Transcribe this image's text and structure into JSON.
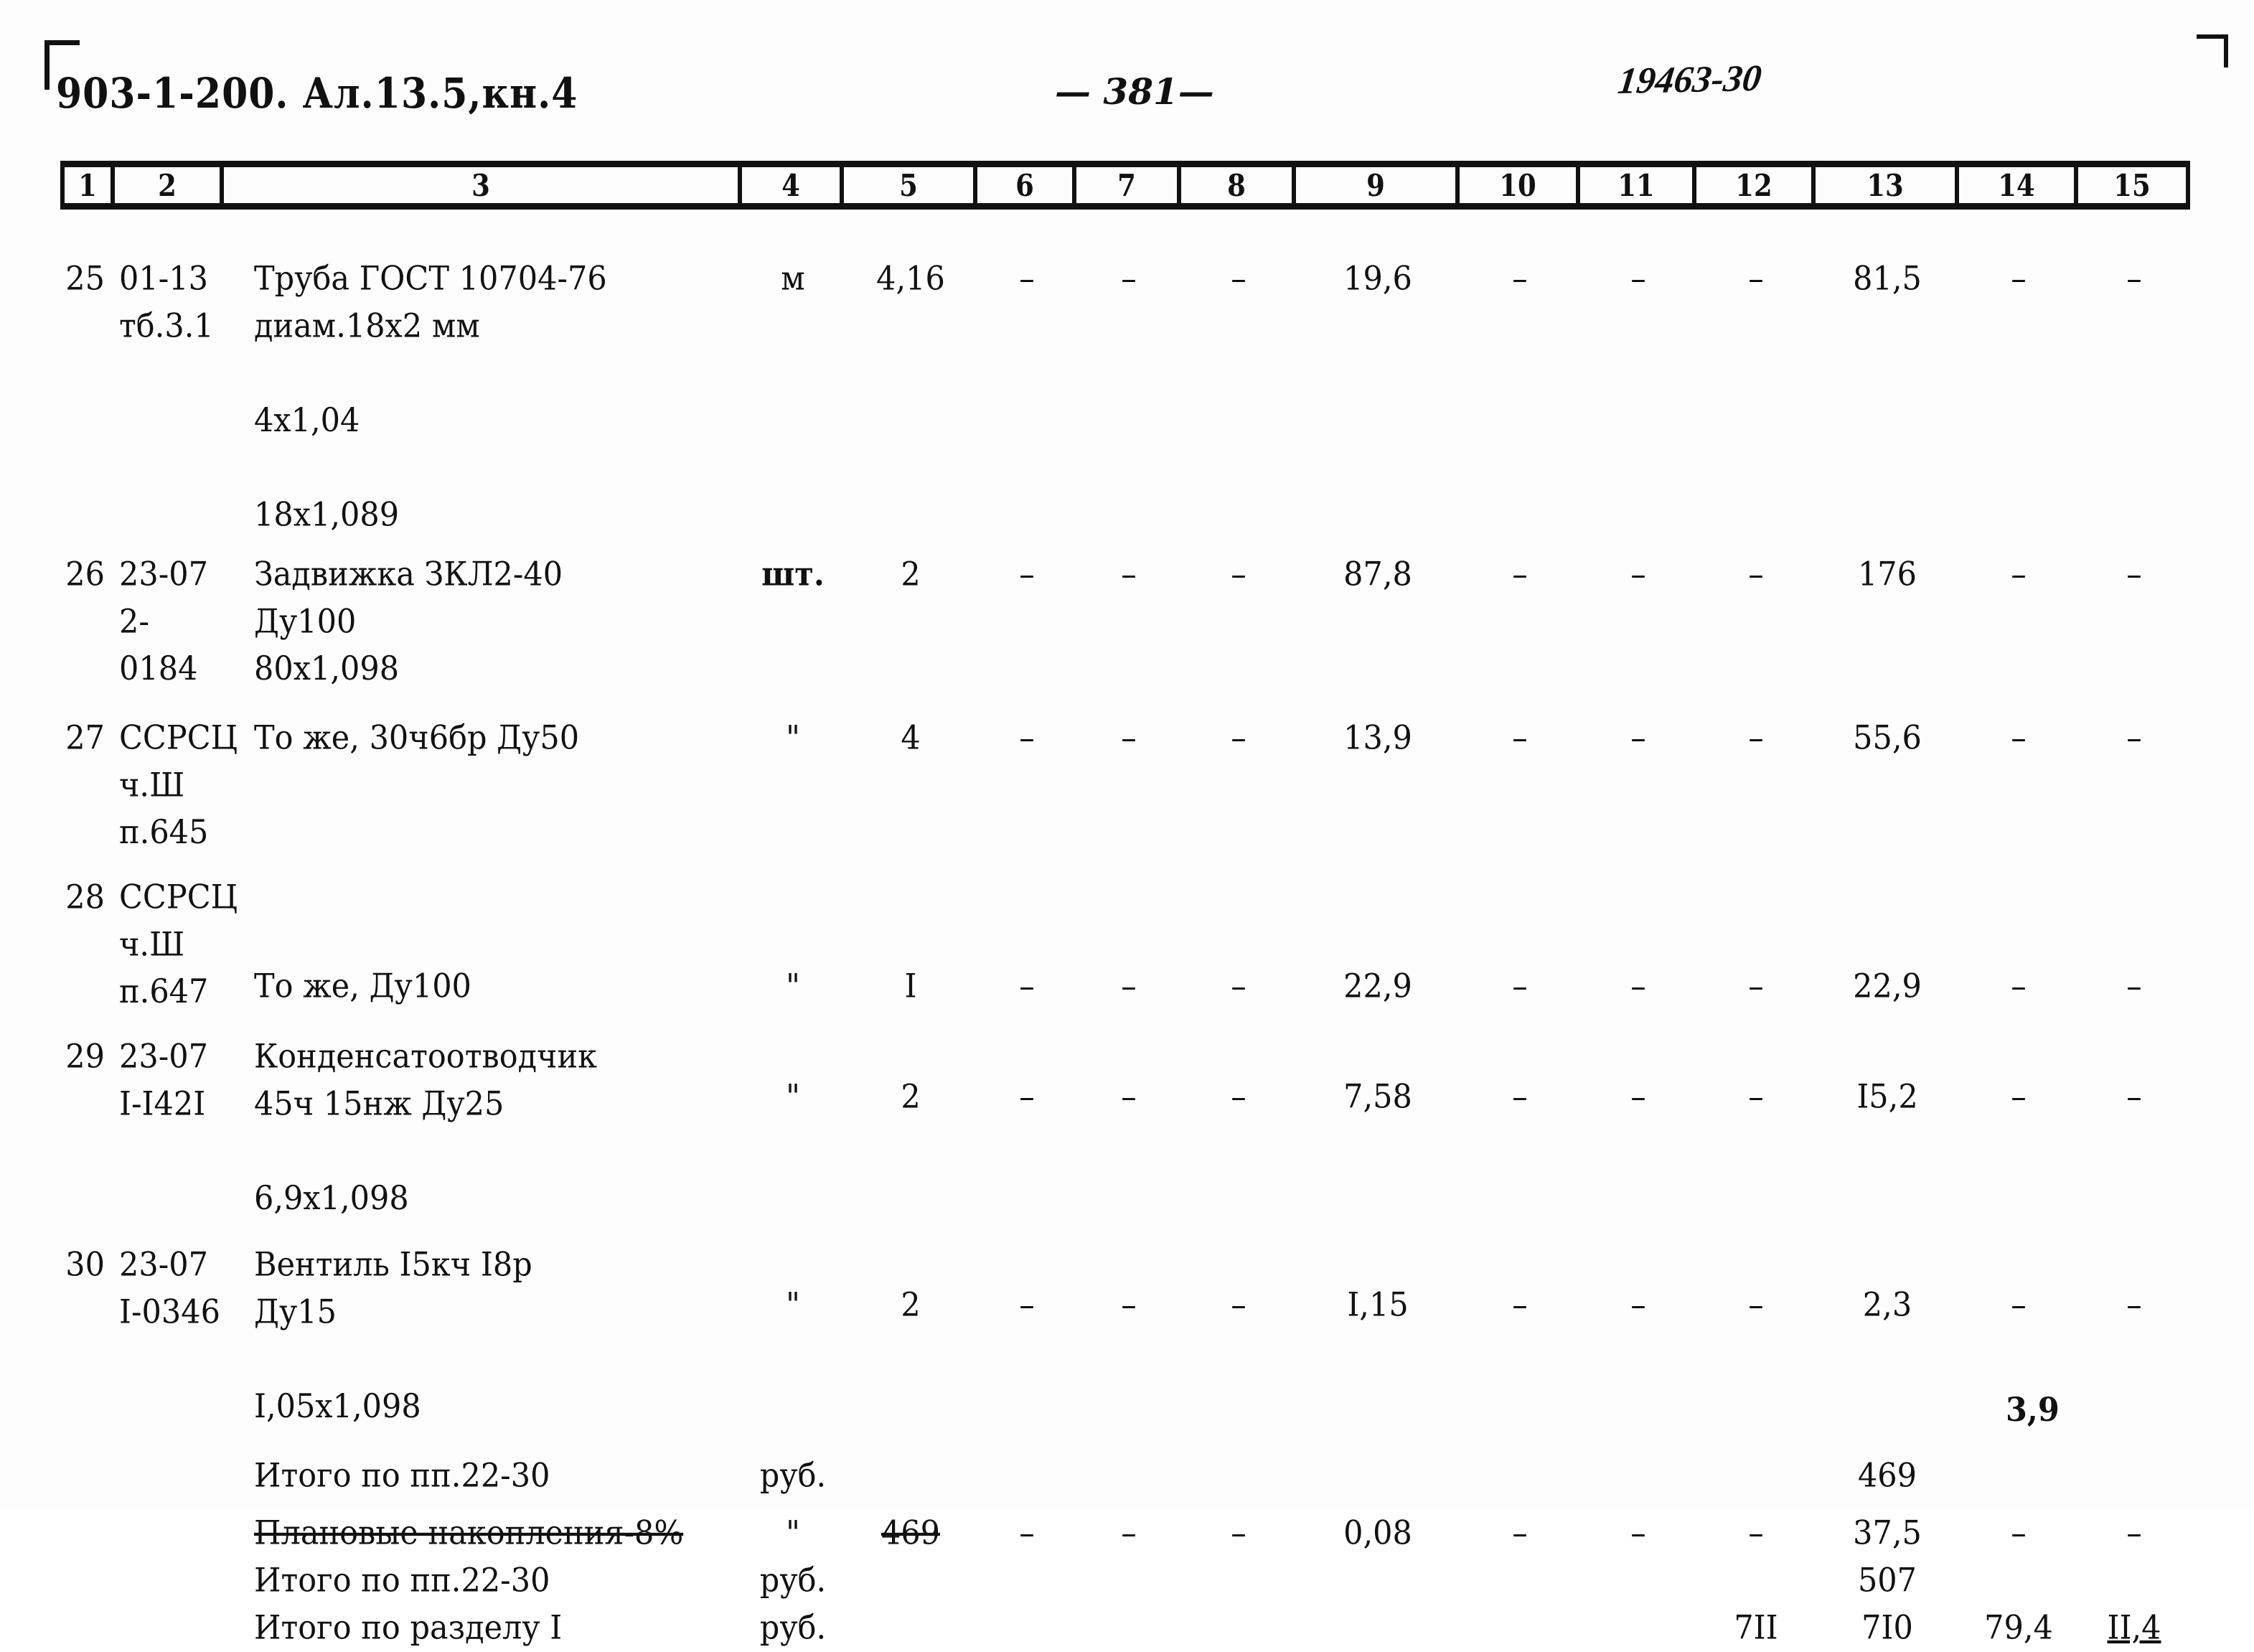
{
  "header": {
    "doc_code": "903-1-200. Ал.13.5,кн.4",
    "page_number": "— 381—",
    "stamp": "19463-30"
  },
  "table": {
    "column_headers": [
      "1",
      "2",
      "3",
      "4",
      "5",
      "6",
      "7",
      "8",
      "9",
      "10",
      "11",
      "12",
      "13",
      "14",
      "15"
    ],
    "rows": [
      {
        "index": "25",
        "code": "01-13\nтб.3.1",
        "description": "Труба ГОСТ 10704-76\nдиам.18х2 мм\n\n4х1,04\n\n18х1,089",
        "unit": "м",
        "c5": "4,16",
        "c6": "–",
        "c7": "–",
        "c8": "–",
        "c9": "19,6",
        "c10": "–",
        "c11": "–",
        "c12": "–",
        "c13": "81,5",
        "c14": "–",
        "c15": "–"
      },
      {
        "index": "26",
        "code": "23-07\n2-0184",
        "description": "Задвижка ЗКЛ2-40\nДу100\n80х1,098",
        "unit": "шт.",
        "c5": "2",
        "c6": "–",
        "c7": "–",
        "c8": "–",
        "c9": "87,8",
        "c10": "–",
        "c11": "–",
        "c12": "–",
        "c13": "176",
        "c14": "–",
        "c15": "–"
      },
      {
        "index": "27",
        "code": "ССРСЦ\nч.Ш\nп.645",
        "description": "То же, 30ч6бр Ду50",
        "unit": "\"",
        "c5": "4",
        "c6": "–",
        "c7": "–",
        "c8": "–",
        "c9": "13,9",
        "c10": "–",
        "c11": "–",
        "c12": "–",
        "c13": "55,6",
        "c14": "–",
        "c15": "–"
      },
      {
        "index": "28",
        "code": "ССРСЦ\nч.Ш\nп.647",
        "description": "То же, Ду100",
        "unit": "\"",
        "c5": "I",
        "c6": "–",
        "c7": "–",
        "c8": "–",
        "c9": "22,9",
        "c10": "–",
        "c11": "–",
        "c12": "–",
        "c13": "22,9",
        "c14": "–",
        "c15": "–"
      },
      {
        "index": "29",
        "code": "23-07\nI-I42I",
        "description": "Конденсатоотводчик\n45ч 15нж Ду25\n\n6,9х1,098",
        "unit": "\"",
        "c5": "2",
        "c6": "–",
        "c7": "–",
        "c8": "–",
        "c9": "7,58",
        "c10": "–",
        "c11": "–",
        "c12": "–",
        "c13": "I5,2",
        "c14": "–",
        "c15": "–"
      },
      {
        "index": "30",
        "code": "23-07\nI-0346",
        "description": "Вентиль I5кч I8р\nДу15\n\nI,05х1,098",
        "unit": "\"",
        "c5": "2",
        "c6": "–",
        "c7": "–",
        "c8": "–",
        "c9": "I,15",
        "c10": "–",
        "c11": "–",
        "c12": "–",
        "c13": "2,3",
        "c14": "–",
        "c15": "–"
      }
    ],
    "summary_rows": [
      {
        "label": "Итого по пп.22-30",
        "unit": "руб.",
        "c5": "",
        "c6": "",
        "c7": "",
        "c8": "",
        "c9": "",
        "c10": "",
        "c11": "",
        "c12": "",
        "c13": "469",
        "c14": "",
        "c15": ""
      },
      {
        "label": "Плановые накопления-8%",
        "unit": "\"",
        "c5": "469",
        "c6": "–",
        "c7": "–",
        "c8": "–",
        "c9": "0,08",
        "c10": "–",
        "c11": "–",
        "c12": "–",
        "c13": "37,5",
        "c14": "–",
        "c15": "–"
      },
      {
        "label": "Итого по пп.22-30",
        "unit": "руб.",
        "c5": "",
        "c6": "",
        "c7": "",
        "c8": "",
        "c9": "",
        "c10": "",
        "c11": "",
        "c12": "",
        "c13": "507",
        "c14": "",
        "c15": ""
      },
      {
        "label": "Итого по разделу I",
        "unit": "руб.",
        "c5": "",
        "c6": "",
        "c7": "",
        "c8": "",
        "c9": "",
        "c10": "",
        "c11": "",
        "c12": "7II",
        "c13": "7I0",
        "c14": "79,4",
        "c15": "II,4"
      }
    ],
    "footnote_value": "3,9"
  }
}
